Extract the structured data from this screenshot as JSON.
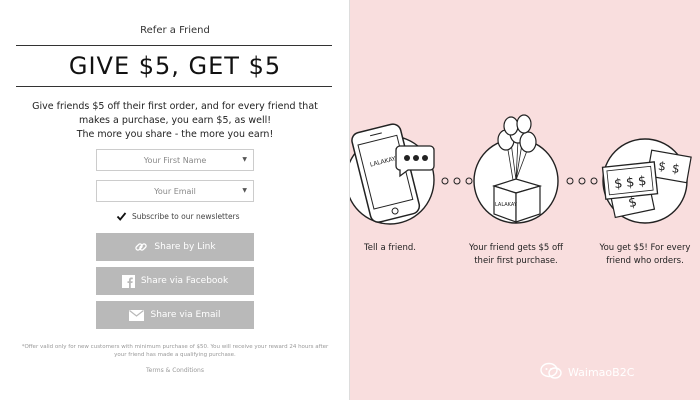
{
  "form": {
    "kicker": "Refer a Friend",
    "headline": "GIVE $5, GET $5",
    "description_lines": [
      "Give friends $5 off their first order, and for every friend that",
      "makes a purchase, you earn $5, as well!",
      "The more you share - the more you earn!"
    ],
    "first_name_placeholder": "Your First Name",
    "email_placeholder": "Your Email",
    "subscribe_label": "Subscribe to our newsletters",
    "subscribe_checked": true,
    "share_link_label": "Share by Link",
    "share_facebook_label": "Share via Facebook",
    "share_email_label": "Share via Email",
    "fine_print": "*Offer valid only for new customers with minimum purchase of $50. You will receive your reward 24 hours after your friend has made a qualifying purchase.",
    "terms_label": "Terms & Conditions"
  },
  "steps": [
    {
      "text": "Tell a friend.",
      "icon": "phone-icon"
    },
    {
      "text_lines": [
        "Your friend gets $5 off",
        "their first purchase."
      ],
      "icon": "gift-box-balloons-icon"
    },
    {
      "text_lines": [
        "You get $5! For every",
        "friend who orders."
      ],
      "icon": "money-bills-icon"
    }
  ],
  "brand_mark": "LALAKAY",
  "watermark": "WaimaoB2C",
  "colors": {
    "right_bg": "#f9dede",
    "button_gray": "#b9b9b9"
  }
}
